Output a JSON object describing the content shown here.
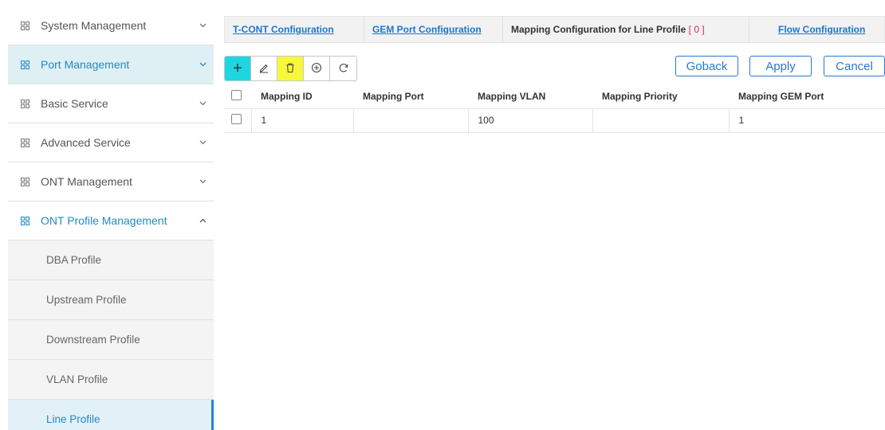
{
  "sidebar": {
    "items": [
      {
        "label": "System Management",
        "icon": "grid-icon",
        "chevron": "chevron-down-icon"
      },
      {
        "label": "Port Management",
        "icon": "grid-icon",
        "chevron": "chevron-down-icon"
      },
      {
        "label": "Basic Service",
        "icon": "grid-icon",
        "chevron": "chevron-down-icon"
      },
      {
        "label": "Advanced Service",
        "icon": "grid-icon",
        "chevron": "chevron-down-icon"
      },
      {
        "label": "ONT Management",
        "icon": "grid-icon",
        "chevron": "chevron-down-icon"
      },
      {
        "label": "ONT Profile Management",
        "icon": "grid-icon",
        "chevron": "chevron-up-icon"
      }
    ],
    "subitems": [
      {
        "label": "DBA Profile"
      },
      {
        "label": "Upstream Profile"
      },
      {
        "label": "Downstream Profile"
      },
      {
        "label": "VLAN Profile"
      },
      {
        "label": "Line Profile"
      }
    ]
  },
  "tabs": {
    "tcont": "T-CONT Configuration",
    "gemport": "GEM Port Configuration",
    "mapping": "Mapping Configuration for Line Profile",
    "mapping_count": "[ 0 ]",
    "flow": "Flow Configuration"
  },
  "toolbar": {
    "add": "+",
    "edit": "edit-icon",
    "delete": "trash-icon",
    "zoom": "plus-circle-icon",
    "refresh": "refresh-icon"
  },
  "actions": {
    "goback": "Goback",
    "apply": "Apply",
    "cancel": "Cancel"
  },
  "table": {
    "headers": [
      "Mapping ID",
      "Mapping Port",
      "Mapping VLAN",
      "Mapping Priority",
      "Mapping GEM Port"
    ],
    "rows": [
      [
        "1",
        "",
        "100",
        "",
        "1"
      ]
    ]
  },
  "colors": {
    "accent": "#2489c5",
    "link": "#1976d2",
    "add_button": "#1fd6e0",
    "delete_button": "#f8f83a",
    "count": "#e91e63"
  }
}
